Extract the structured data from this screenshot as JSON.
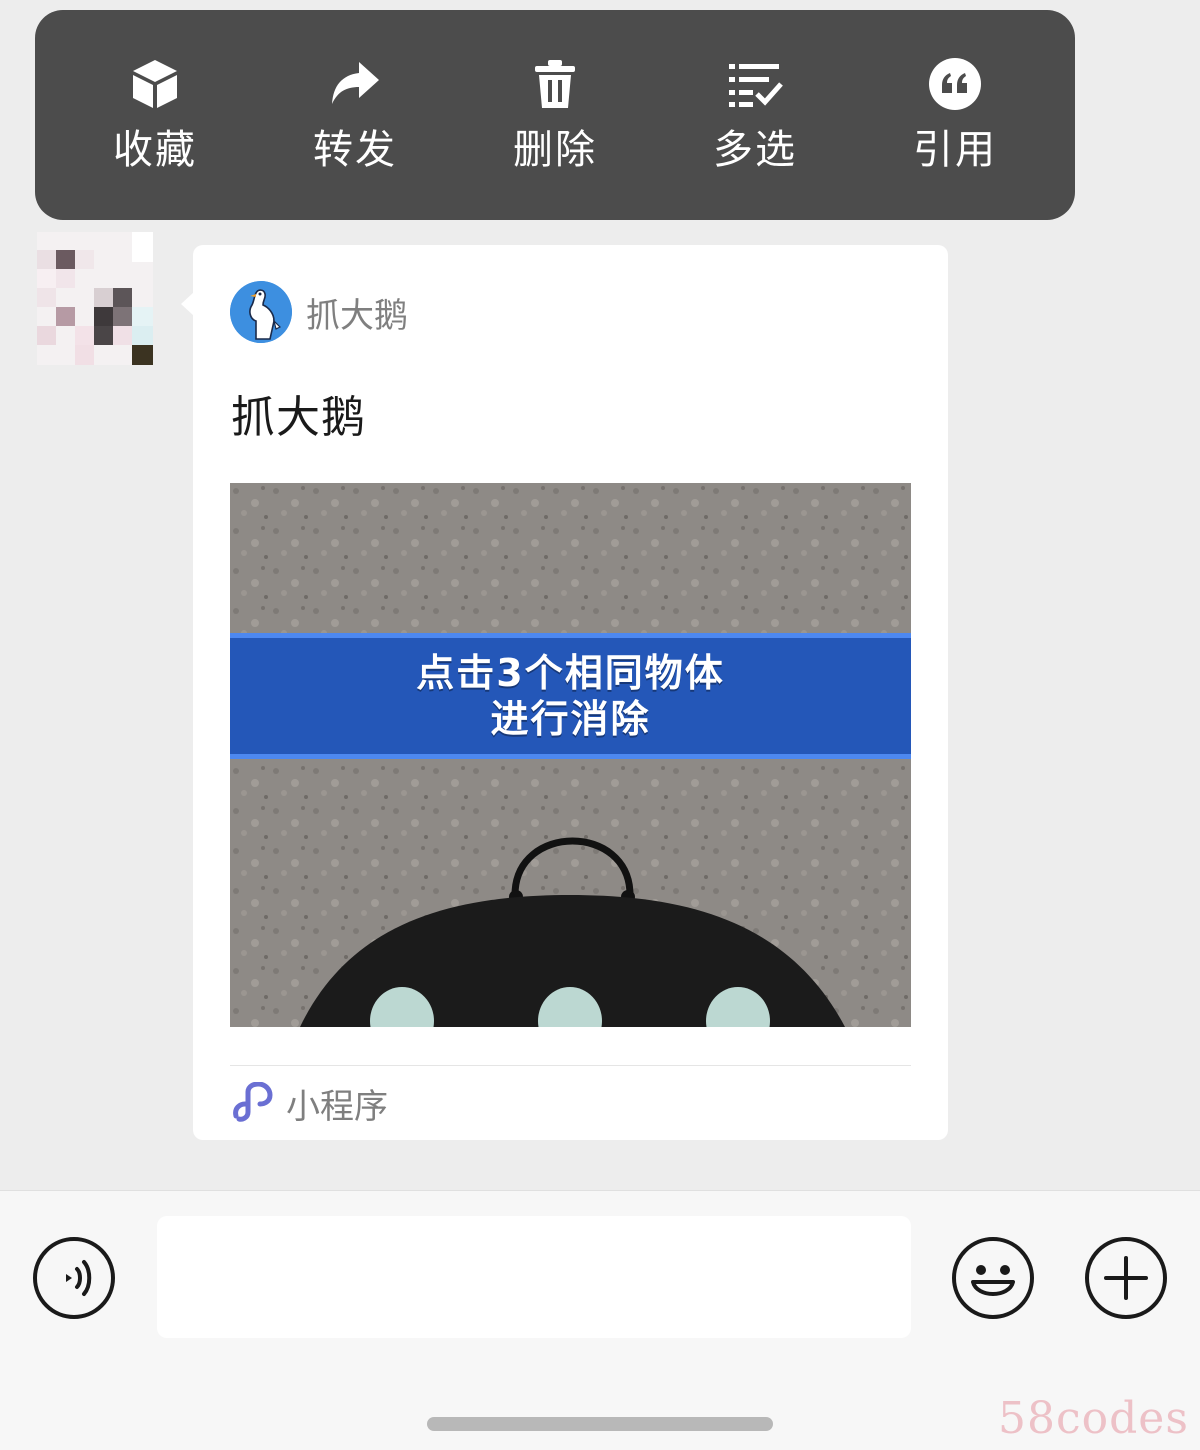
{
  "context_menu": {
    "items": [
      {
        "label": "收藏",
        "icon": "cube-icon"
      },
      {
        "label": "转发",
        "icon": "share-arrow-icon"
      },
      {
        "label": "删除",
        "icon": "trash-icon"
      },
      {
        "label": "多选",
        "icon": "multi-select-list-icon"
      },
      {
        "label": "引用",
        "icon": "quote-icon"
      }
    ]
  },
  "message": {
    "sender_avatar": "pixelated-avatar",
    "card": {
      "app_name": "抓大鹅",
      "app_logo_icon": "goose-logo-icon",
      "title": "抓大鹅",
      "thumbnail": {
        "banner_line1": "点击3个相同物体",
        "banner_line2": "进行消除"
      },
      "footer_icon": "mini-program-icon",
      "footer_label": "小程序"
    }
  },
  "input_bar": {
    "voice_icon": "voice-icon",
    "emoji_icon": "emoji-icon",
    "plus_icon": "plus-icon",
    "input_value": ""
  },
  "watermark": "58codes",
  "colors": {
    "menu_bg": "#4c4c4c",
    "chat_bg": "#ededed",
    "banner_blue": "#2457b8",
    "mini_program_purple": "#6a6fd3"
  }
}
